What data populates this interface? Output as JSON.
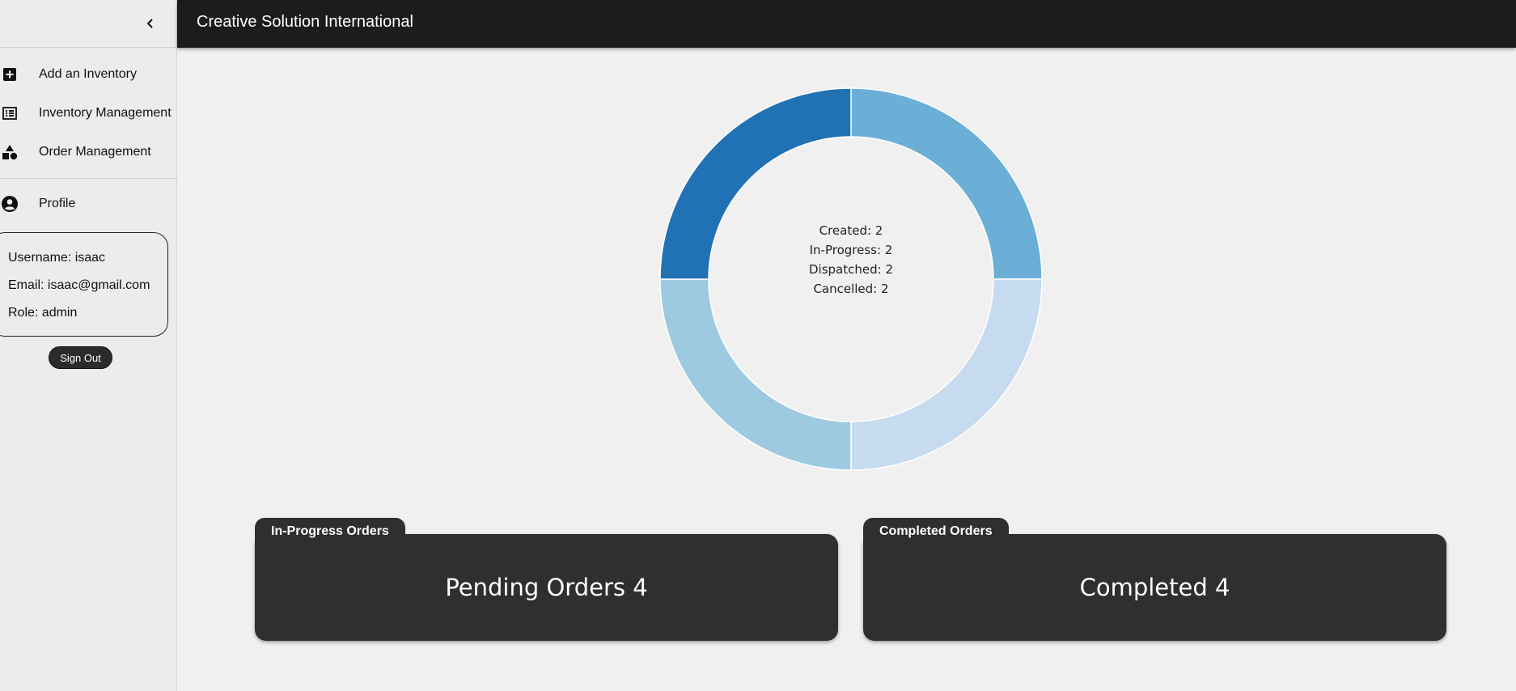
{
  "app": {
    "title": "Creative Solution International"
  },
  "sidebar": {
    "collapse_icon": "chevron-left-icon",
    "items": [
      {
        "label": "Add an Inventory",
        "icon": "add-box-icon"
      },
      {
        "label": "Inventory Management",
        "icon": "list-icon"
      },
      {
        "label": "Order Management",
        "icon": "category-shapes-icon"
      },
      {
        "label": "Profile",
        "icon": "account-circle-icon"
      }
    ],
    "profile": {
      "username": "Username: isaac",
      "email": "Email: isaac@gmail.com",
      "role": "Role: admin"
    },
    "sign_out_label": "Sign Out"
  },
  "chart_data": {
    "type": "pie",
    "style": "doughnut",
    "categories": [
      "Created",
      "In-Progress",
      "Dispatched",
      "Cancelled"
    ],
    "values": [
      2,
      2,
      2,
      2
    ],
    "colors": [
      "#6baed6",
      "#c6dbef",
      "#9ecae1",
      "#2171b5"
    ],
    "labels": [
      "Created: 2",
      "In-Progress: 2",
      "Dispatched: 2",
      "Cancelled: 2"
    ]
  },
  "cards": [
    {
      "tab": "In-Progress Orders",
      "value": "Pending Orders 4"
    },
    {
      "tab": "Completed Orders",
      "value": "Completed 4"
    }
  ]
}
